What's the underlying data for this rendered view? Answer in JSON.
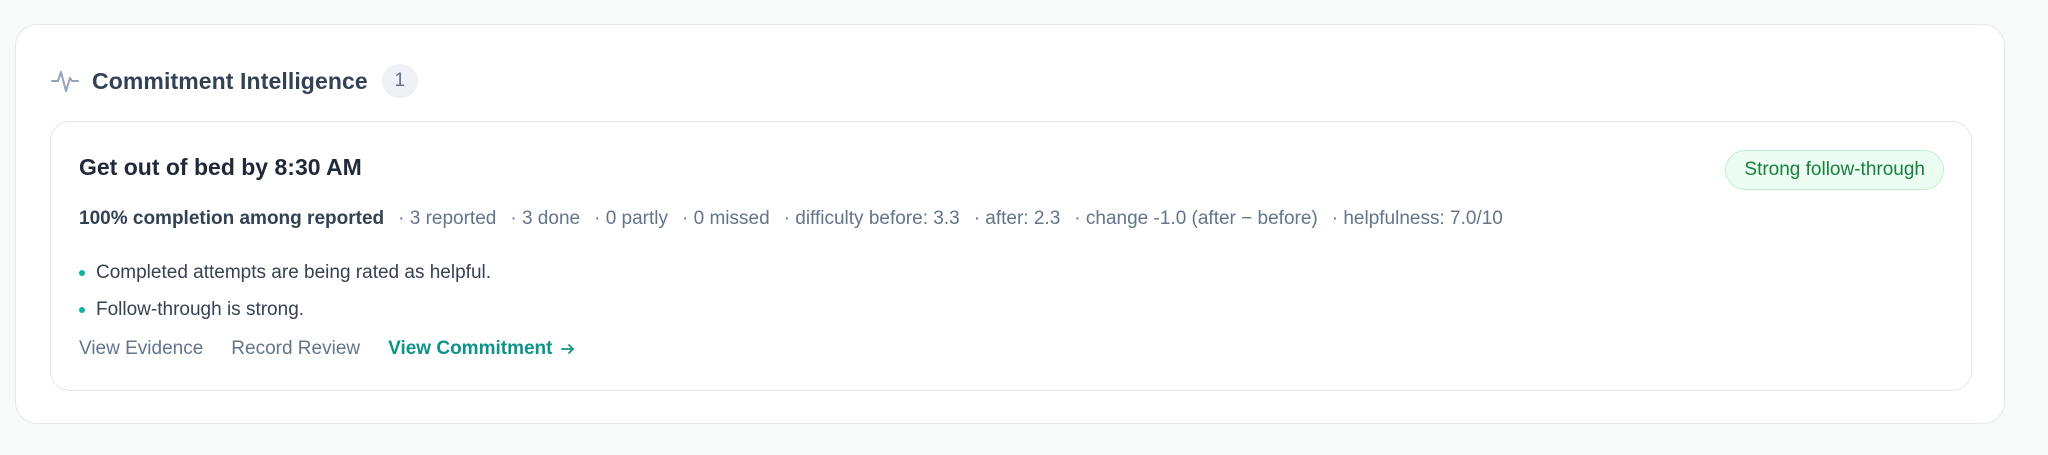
{
  "section": {
    "title": "Commitment Intelligence",
    "count": "1",
    "icon": "activity-pulse-icon"
  },
  "card": {
    "title": "Get out of bed by 8:30 AM",
    "status_label": "Strong follow-through",
    "metrics": {
      "primary": "100% completion among reported",
      "items": [
        "· 3 reported",
        "· 3 done",
        "· 0 partly",
        "· 0 missed",
        "· difficulty before: 3.3",
        "· after: 2.3",
        "· change -1.0 (after − before)",
        "· helpfulness: 7.0/10"
      ]
    },
    "insights": [
      "Completed attempts are being rated as helpful.",
      "Follow-through is strong."
    ],
    "actions": {
      "view_evidence": "View Evidence",
      "record_review": "Record Review",
      "view_commitment": "View Commitment"
    }
  },
  "colors": {
    "accent": "#0d9488",
    "success": "#16803c",
    "success_bg": "#ecfdf3",
    "muted": "#64748b"
  }
}
